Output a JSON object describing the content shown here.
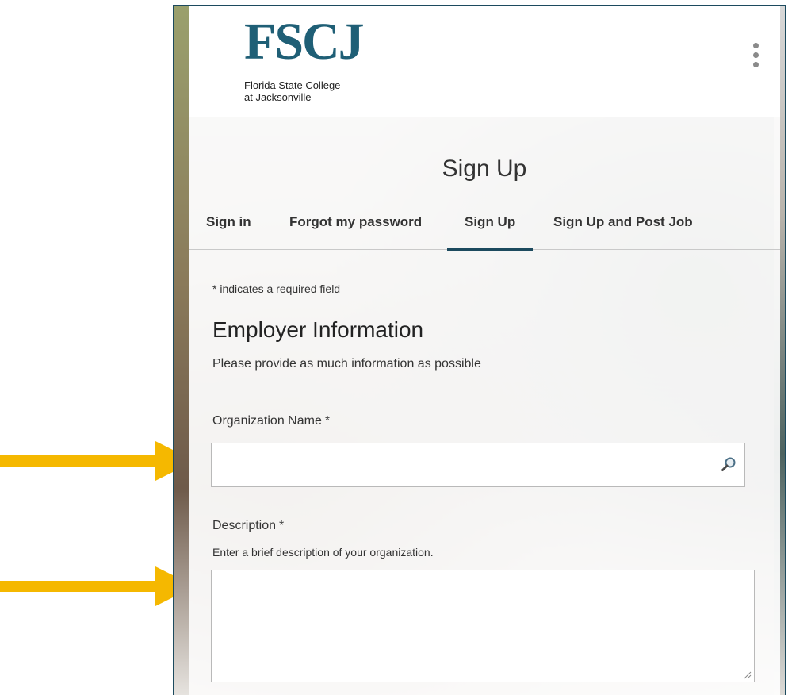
{
  "logo": {
    "mark": "FSCJ",
    "line1": "Florida State College",
    "line2": "at Jacksonville"
  },
  "header": {
    "menu_icon": "kebab-menu-icon",
    "title": "Sign Up"
  },
  "tabs": [
    {
      "label": "Sign in",
      "active": false
    },
    {
      "label": "Forgot my password",
      "active": false
    },
    {
      "label": "Sign Up",
      "active": true
    },
    {
      "label": "Sign Up and Post Job",
      "active": false
    }
  ],
  "form": {
    "required_note": "* indicates a required field",
    "section_title": "Employer Information",
    "section_subtitle": "Please provide as much information as possible",
    "org_name": {
      "label": "Organization Name",
      "required_marker": "*",
      "value": "",
      "icon": "search-icon"
    },
    "description": {
      "label": "Description",
      "required_marker": "*",
      "help": "Enter a brief description of your organization.",
      "value": ""
    }
  },
  "colors": {
    "brand": "#1f5f76",
    "frame_border": "#1c4a5e",
    "tab_underline": "#1c4a5e",
    "arrow": "#f5b800"
  },
  "annotations": {
    "arrow_icon": "arrow-right-icon"
  }
}
